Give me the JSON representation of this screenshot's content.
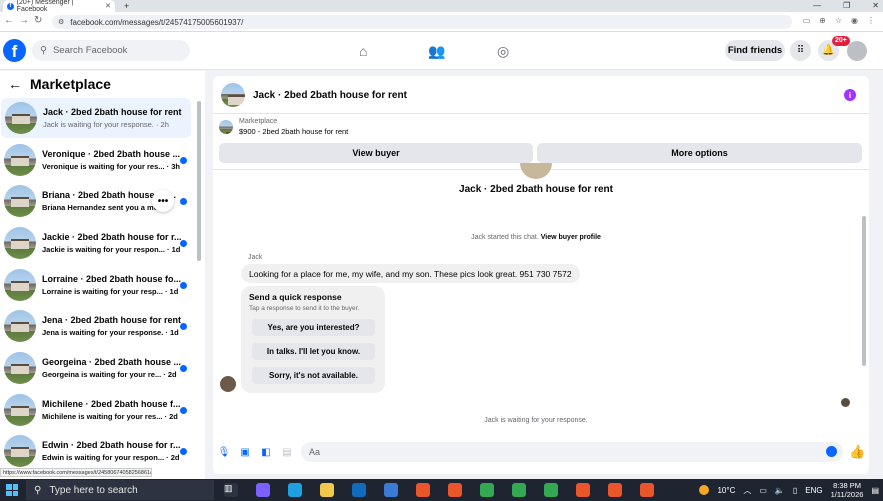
{
  "browser": {
    "tab_title": "(20+) Messenger | Facebook",
    "url": "facebook.com/messages/t/245741750056019​37/",
    "status_url": "https://www.facebook.com/messages/t/24580674058256861/"
  },
  "header": {
    "search_placeholder": "Search Facebook",
    "find_friends": "Find friends",
    "notif_badge": "20+"
  },
  "sidebar": {
    "title": "Marketplace",
    "conversations": [
      {
        "name": "Jack · 2bed 2bath house for rent",
        "sub": "Jack is waiting for your response. · 2h"
      },
      {
        "name": "Veronique · 2bed 2bath house ...",
        "sub": "Veronique is waiting for your res... · 3h"
      },
      {
        "name": "Briana · 2bed 2bath house for...",
        "sub": "Briana Hernandez sent you a me..."
      },
      {
        "name": "Jackie · 2bed 2bath house for r...",
        "sub": "Jackie is waiting for your respon... · 1d"
      },
      {
        "name": "Lorraine · 2bed 2bath house fo...",
        "sub": "Lorraine is waiting for your resp... · 1d"
      },
      {
        "name": "Jena · 2bed 2bath house for rent",
        "sub": "Jena is waiting for your response. · 1d"
      },
      {
        "name": "Georgeina · 2bed 2bath house ...",
        "sub": "Georgeina is waiting for your re... · 2d"
      },
      {
        "name": "Michilene · 2bed 2bath house f...",
        "sub": "Michilene is waiting for your res... · 2d"
      },
      {
        "name": "Edwin · 2bed 2bath house for r...",
        "sub": "Edwin is waiting for your respon... · 2d"
      }
    ]
  },
  "chat": {
    "title": "Jack · 2bed 2bath house for rent",
    "marketplace_label": "Marketplace",
    "listing": "$900 - 2bed 2bath house for rent",
    "view_buyer": "View buyer",
    "more_options": "More options",
    "centre_title": "Jack · 2bed 2bath house for rent",
    "started_text": "Jack started this chat.",
    "view_profile": "View buyer profile",
    "sender": "Jack",
    "message": "Looking for a place for me, my wife, and my son. These pics look great. 951 730 7572",
    "quick_title": "Send a quick response",
    "quick_sub": "Tap a response to send it to the buyer.",
    "quick_options": [
      "Yes, are you interested?",
      "In talks. I'll let you know.",
      "Sorry, it's not available."
    ],
    "waiting": "Jack is waiting for your response.",
    "composer_placeholder": "Aa"
  },
  "taskbar": {
    "search_placeholder": "Type here to search",
    "temperature": "10°C",
    "time": "8:38 PM",
    "date": "1/11/2026"
  },
  "colors": {
    "accent": "#0866ff",
    "badge": "#e41e3f"
  }
}
